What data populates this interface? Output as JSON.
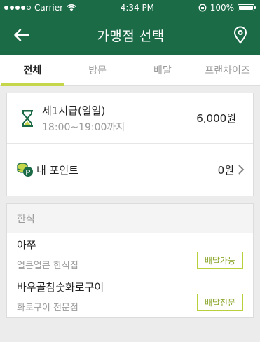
{
  "status_bar": {
    "carrier": "Carrier",
    "time": "4:34 PM",
    "battery": "100%"
  },
  "header": {
    "title": "가맹점 선택",
    "back_icon": "arrow-left-icon",
    "location_icon": "location-pin-icon"
  },
  "tabs": [
    {
      "label": "전체",
      "active": true
    },
    {
      "label": "방문",
      "active": false
    },
    {
      "label": "배달",
      "active": false
    },
    {
      "label": "프랜차이즈",
      "active": false
    }
  ],
  "slot": {
    "name": "제1지급(일일)",
    "time": "18:00~19:00까지",
    "price": "6,000원"
  },
  "points": {
    "label": "내 포인트",
    "value": "0원"
  },
  "category": "한식",
  "stores": [
    {
      "name": "아쭈",
      "desc": "얼큰얼큰 한식집",
      "badge": "배달가능"
    },
    {
      "name": "바우골참숯화로구이",
      "desc": "화로구이 전문점",
      "badge": "배달전문"
    }
  ],
  "colors": {
    "primary": "#1b6b47",
    "accent": "#c5d64a",
    "badge": "#8aa62a"
  }
}
